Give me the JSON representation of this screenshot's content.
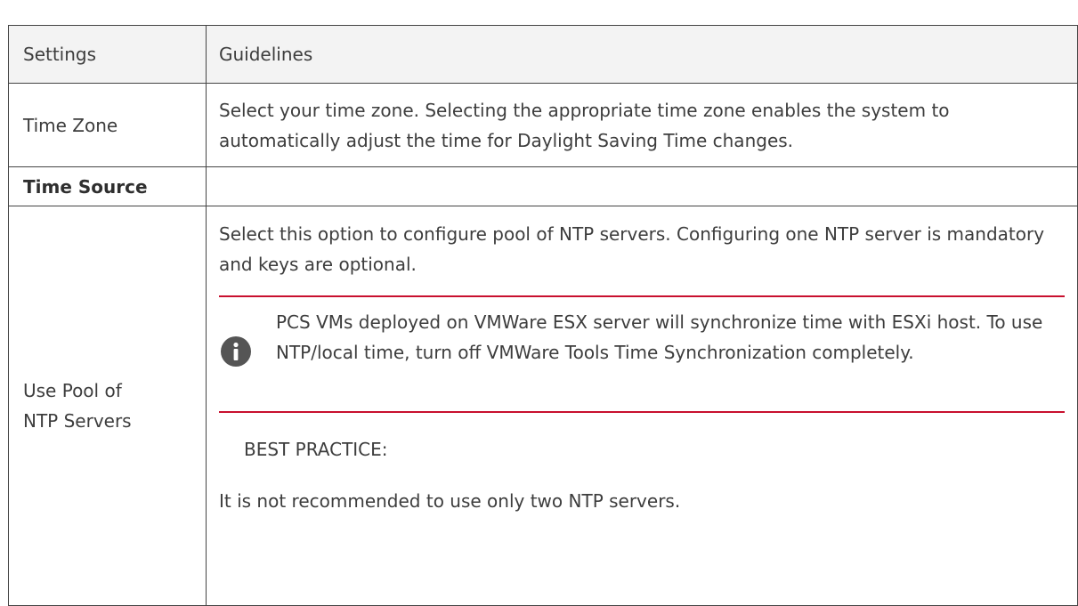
{
  "table": {
    "header": {
      "settings": "Settings",
      "guidelines": "Guidelines"
    },
    "rows": [
      {
        "setting": "Time Zone",
        "guideline": "Select your time zone. Selecting the appropriate time zone enables the system to automatically adjust the time for Daylight Saving Time changes."
      },
      {
        "setting": "Time Source",
        "guideline": ""
      },
      {
        "setting": "Use Pool of NTP Servers",
        "guideline": "Select this option to configure pool of NTP servers. Configuring one NTP server is mandatory and keys are optional.",
        "note": {
          "icon": "info-icon",
          "text": "PCS VMs deployed on VMWare ESX server will synchronize time with ESXi host. To use NTP/local time, turn off VMWare Tools Time Synchronization completely."
        },
        "best_practice_label": "BEST PRACTICE:",
        "best_practice_text": "It is not recommended to use only two NTP servers."
      }
    ]
  },
  "colors": {
    "note_rule": "#c8102e",
    "border": "#444444",
    "text": "#3d3d3d"
  }
}
